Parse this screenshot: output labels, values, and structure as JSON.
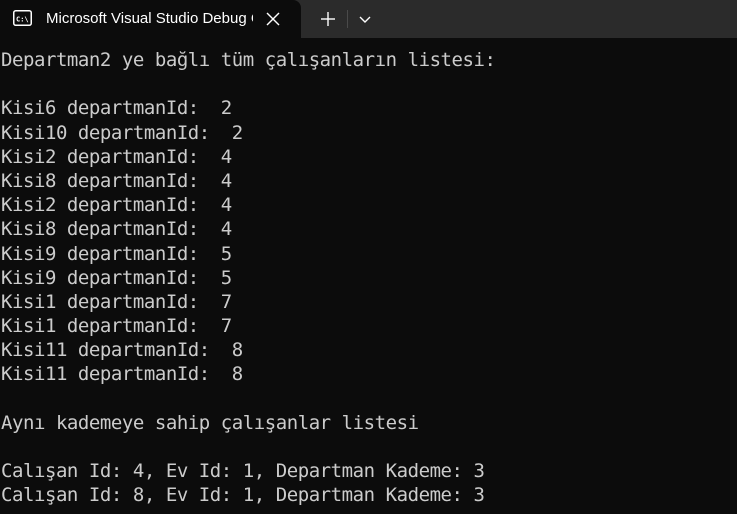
{
  "window": {
    "tab_title": "Microsoft Visual Studio Debug Console",
    "tab_icon": "console-app-icon",
    "close_icon": "close-icon",
    "new_tab_icon": "plus-icon",
    "dropdown_icon": "chevron-down-icon"
  },
  "colors": {
    "background": "#0c0c0c",
    "tabbar": "#2b2b2b",
    "text": "#cccccc"
  },
  "console": {
    "lines": [
      "Departman2 ye bağlı tüm çalışanların listesi:",
      "",
      "Kisi6 departmanId:  2",
      "Kisi10 departmanId:  2",
      "Kisi2 departmanId:  4",
      "Kisi8 departmanId:  4",
      "Kisi2 departmanId:  4",
      "Kisi8 departmanId:  4",
      "Kisi9 departmanId:  5",
      "Kisi9 departmanId:  5",
      "Kisi1 departmanId:  7",
      "Kisi1 departmanId:  7",
      "Kisi11 departmanId:  8",
      "Kisi11 departmanId:  8",
      "",
      "Aynı kademeye sahip çalışanlar listesi",
      "",
      "Calışan Id: 4, Ev Id: 1, Departman Kademe: 3",
      "Calışan Id: 8, Ev Id: 1, Departman Kademe: 3"
    ]
  }
}
